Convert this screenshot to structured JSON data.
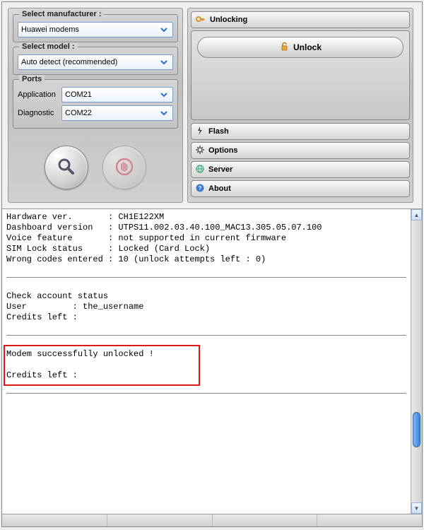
{
  "left": {
    "manufacturer": {
      "title": "Select manufacturer :",
      "value": "Huawei modems"
    },
    "model": {
      "title": "Select model :",
      "value": "Auto detect (recommended)"
    },
    "ports": {
      "title": "Ports",
      "app_label": "Application",
      "app_value": "COM21",
      "diag_label": "Diagnostic",
      "diag_value": "COM22"
    }
  },
  "right": {
    "sections": {
      "unlocking": "Unlocking",
      "flash": "Flash",
      "options": "Options",
      "server": "Server",
      "about": "About"
    },
    "unlock_button": "Unlock"
  },
  "log": {
    "l1": "Hardware ver.       : CH1E122XM",
    "l2": "Dashboard version   : UTPS11.002.03.40.100_MAC13.305.05.07.100",
    "l3": "Voice feature       : not supported in current firmware",
    "l4": "SIM Lock status     : Locked (Card Lock)",
    "l5": "Wrong codes entered : 10 (unlock attempts left : 0)",
    "l6": "Check account status",
    "l7": "User         : the_username",
    "l8": "Credits left :",
    "l9": "Modem successfully unlocked !",
    "l10": "Credits left :"
  }
}
